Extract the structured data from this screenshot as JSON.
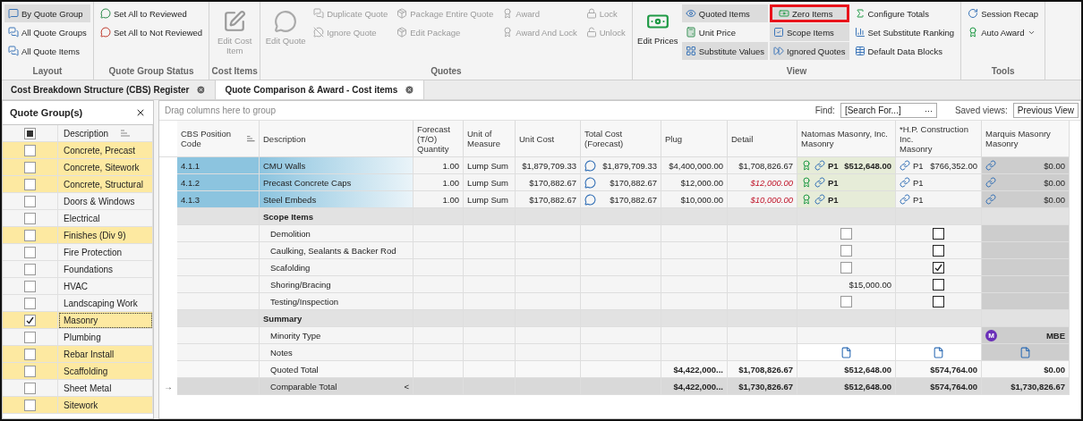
{
  "ribbon": {
    "groups": [
      {
        "label": "Layout",
        "columns": [
          [
            {
              "label": "By Quote Group",
              "kind": "small",
              "selected": true,
              "disabled": false,
              "outlined": false
            },
            {
              "label": "All Quote Groups",
              "kind": "small",
              "selected": false,
              "disabled": false,
              "outlined": false
            },
            {
              "label": "All Quote Items",
              "kind": "small",
              "selected": false,
              "disabled": false,
              "outlined": false
            }
          ]
        ]
      },
      {
        "label": "Quote Group Status",
        "columns": [
          [
            {
              "label": "Set All to Reviewed",
              "kind": "small",
              "selected": false,
              "disabled": false,
              "outlined": false
            },
            {
              "label": "Set All to Not Reviewed",
              "kind": "small",
              "selected": false,
              "disabled": false,
              "outlined": false
            }
          ]
        ]
      },
      {
        "label": "Cost Items",
        "columns": [
          [
            {
              "label": "Edit Cost Item",
              "kind": "large",
              "selected": false,
              "disabled": true,
              "outlined": false
            }
          ]
        ]
      },
      {
        "label": "Quotes",
        "columns": [
          [
            {
              "label": "Edit Quote",
              "kind": "large",
              "selected": false,
              "disabled": true,
              "outlined": false
            }
          ],
          [
            {
              "label": "Duplicate Quote",
              "kind": "small",
              "selected": false,
              "disabled": true,
              "outlined": false
            },
            {
              "label": "Ignore Quote",
              "kind": "small",
              "selected": false,
              "disabled": true,
              "outlined": false
            }
          ],
          [
            {
              "label": "Package Entire Quote",
              "kind": "small",
              "selected": false,
              "disabled": true,
              "outlined": false
            },
            {
              "label": "Edit Package",
              "kind": "small",
              "selected": false,
              "disabled": true,
              "outlined": false
            }
          ],
          [
            {
              "label": "Award",
              "kind": "small",
              "selected": false,
              "disabled": true,
              "outlined": false
            },
            {
              "label": "Award And Lock",
              "kind": "small",
              "selected": false,
              "disabled": true,
              "outlined": false
            }
          ],
          [
            {
              "label": "Lock",
              "kind": "small",
              "selected": false,
              "disabled": true,
              "outlined": false
            },
            {
              "label": "Unlock",
              "kind": "small",
              "selected": false,
              "disabled": true,
              "outlined": false
            }
          ]
        ]
      },
      {
        "label": "View",
        "columns": [
          [
            {
              "label": "Edit Prices",
              "kind": "large",
              "selected": false,
              "disabled": false,
              "outlined": false
            }
          ],
          [
            {
              "label": "Quoted Items",
              "kind": "small",
              "selected": true,
              "disabled": false,
              "outlined": false
            },
            {
              "label": "Unit Price",
              "kind": "small",
              "selected": false,
              "disabled": false,
              "outlined": false
            },
            {
              "label": "Substitute Values",
              "kind": "small",
              "selected": true,
              "disabled": false,
              "outlined": false
            }
          ],
          [
            {
              "label": "Zero Items",
              "kind": "small",
              "selected": true,
              "disabled": false,
              "outlined": true
            },
            {
              "label": "Scope Items",
              "kind": "small",
              "selected": true,
              "disabled": false,
              "outlined": false
            },
            {
              "label": "Ignored Quotes",
              "kind": "small",
              "selected": true,
              "disabled": false,
              "outlined": false
            }
          ],
          [
            {
              "label": "Configure Totals",
              "kind": "small",
              "selected": false,
              "disabled": false,
              "outlined": false
            },
            {
              "label": "Set Substitute Ranking",
              "kind": "small",
              "selected": false,
              "disabled": false,
              "outlined": false
            },
            {
              "label": "Default Data Blocks",
              "kind": "small",
              "selected": false,
              "disabled": false,
              "outlined": false
            }
          ]
        ]
      },
      {
        "label": "Tools",
        "columns": [
          [
            {
              "label": "Session Recap",
              "kind": "small",
              "selected": false,
              "disabled": false,
              "outlined": false,
              "dropdown": false
            },
            {
              "label": "Auto Award",
              "kind": "small",
              "selected": false,
              "disabled": false,
              "outlined": false,
              "dropdown": true
            }
          ]
        ]
      }
    ]
  },
  "tabs": [
    {
      "label": "Cost Breakdown Structure (CBS) Register",
      "selected": false
    },
    {
      "label": "Quote Comparison & Award - Cost items",
      "selected": true
    }
  ],
  "quote_groups": {
    "title": "Quote Group(s)",
    "header": {
      "label": "Description",
      "indeterminate": true
    },
    "rows": [
      {
        "label": "Concrete, Precast",
        "checked": false,
        "highlighted": true,
        "selected": false
      },
      {
        "label": "Concrete, Sitework",
        "checked": false,
        "highlighted": true,
        "selected": false
      },
      {
        "label": "Concrete, Structural",
        "checked": false,
        "highlighted": true,
        "selected": false
      },
      {
        "label": "Doors & Windows",
        "checked": false,
        "highlighted": false,
        "selected": false
      },
      {
        "label": "Electrical",
        "checked": false,
        "highlighted": false,
        "selected": false
      },
      {
        "label": "Finishes (Div 9)",
        "checked": false,
        "highlighted": true,
        "selected": false
      },
      {
        "label": "Fire Protection",
        "checked": false,
        "highlighted": false,
        "selected": false
      },
      {
        "label": "Foundations",
        "checked": false,
        "highlighted": false,
        "selected": false
      },
      {
        "label": "HVAC",
        "checked": false,
        "highlighted": false,
        "selected": false
      },
      {
        "label": "Landscaping Work",
        "checked": false,
        "highlighted": false,
        "selected": false
      },
      {
        "label": "Masonry",
        "checked": true,
        "highlighted": true,
        "selected": true
      },
      {
        "label": "Plumbing",
        "checked": false,
        "highlighted": false,
        "selected": false
      },
      {
        "label": "Rebar Install",
        "checked": false,
        "highlighted": true,
        "selected": false
      },
      {
        "label": "Scaffolding",
        "checked": false,
        "highlighted": true,
        "selected": false
      },
      {
        "label": "Sheet Metal",
        "checked": false,
        "highlighted": false,
        "selected": false
      },
      {
        "label": "Sitework",
        "checked": false,
        "highlighted": true,
        "selected": false
      }
    ]
  },
  "grid": {
    "group_hint": "Drag columns here to group",
    "find": {
      "label": "Find:",
      "placeholder": "[Search For...]",
      "button": "···"
    },
    "saved_views": {
      "label": "Saved views:",
      "value": "Previous View"
    },
    "columns": [
      {
        "label": "CBS Position Code",
        "sorted": true
      },
      {
        "label": "Description",
        "sorted": false
      },
      {
        "label": "Forecast (T/O) Quantity",
        "sorted": false
      },
      {
        "label": "Unit of Measure",
        "sorted": false
      },
      {
        "label": "Unit Cost",
        "sorted": false
      },
      {
        "label": "Total Cost (Forecast)",
        "sorted": false
      },
      {
        "label": "Plug",
        "sorted": false
      },
      {
        "label": "Detail",
        "sorted": false
      }
    ],
    "vendors": [
      {
        "name": "Natomas Masonry, Inc.",
        "trade": "Masonry",
        "excluded": false
      },
      {
        "name": "*H.P. Construction Inc.",
        "trade": "Masonry",
        "excluded": false
      },
      {
        "name": "Marquis Masonry",
        "trade": "Masonry",
        "excluded": true
      }
    ],
    "rows": [
      {
        "kind": "item",
        "code": "4.1.1",
        "description": "CMU Walls",
        "quantity": "1.00",
        "unit": "Lump Sum",
        "unit_cost": "$1,879,709.33",
        "total": "$1,879,709.33",
        "commented": true,
        "plug": "$4,400,000.00",
        "detail": "$1,708,826.67",
        "detail_overridden": false,
        "quotes": [
          {
            "awarded": true,
            "linked": true,
            "priority": "P1",
            "amount": "$512,648.00"
          },
          {
            "awarded": false,
            "linked": true,
            "priority": "P1",
            "amount": "$766,352.00"
          },
          {
            "awarded": false,
            "linked": true,
            "amount": "$0.00"
          }
        ]
      },
      {
        "kind": "item",
        "code": "4.1.2",
        "description": "Precast Concrete Caps",
        "quantity": "1.00",
        "unit": "Lump Sum",
        "unit_cost": "$170,882.67",
        "total": "$170,882.67",
        "commented": true,
        "plug": "$12,000.00",
        "detail": "$12,000.00",
        "detail_overridden": true,
        "quotes": [
          {
            "awarded": true,
            "linked": true,
            "priority": "P1"
          },
          {
            "awarded": false,
            "linked": true,
            "priority": "P1"
          },
          {
            "awarded": false,
            "linked": true,
            "amount": "$0.00"
          }
        ]
      },
      {
        "kind": "item",
        "code": "4.1.3",
        "description": "Steel Embeds",
        "quantity": "1.00",
        "unit": "Lump Sum",
        "unit_cost": "$170,882.67",
        "total": "$170,882.67",
        "commented": true,
        "plug": "$10,000.00",
        "detail": "$10,000.00",
        "detail_overridden": true,
        "quotes": [
          {
            "awarded": true,
            "linked": true,
            "priority": "P1"
          },
          {
            "awarded": false,
            "linked": true,
            "priority": "P1"
          },
          {
            "awarded": false,
            "linked": true,
            "amount": "$0.00"
          }
        ]
      },
      {
        "kind": "section",
        "label": "Scope Items"
      },
      {
        "kind": "detail",
        "label": "Demolition",
        "quotes": [
          {
            "kind": "check",
            "checked": false
          },
          {
            "kind": "check",
            "checked": false
          }
        ]
      },
      {
        "kind": "detail",
        "label": "Caulking, Sealants & Backer Rod",
        "quotes": [
          {
            "kind": "check",
            "checked": false
          },
          {
            "kind": "check",
            "checked": false
          }
        ]
      },
      {
        "kind": "detail",
        "label": "Scafolding",
        "quotes": [
          {
            "kind": "check",
            "checked": false
          },
          {
            "kind": "check",
            "checked": true
          }
        ]
      },
      {
        "kind": "detail",
        "label": "Shoring/Bracing",
        "quotes": [
          {
            "kind": "value",
            "text": "$15,000.00"
          },
          {
            "kind": "check",
            "checked": false
          }
        ]
      },
      {
        "kind": "detail",
        "label": "Testing/Inspection",
        "quotes": [
          {
            "kind": "check",
            "checked": false
          },
          {
            "kind": "check",
            "checked": false
          }
        ]
      },
      {
        "kind": "section",
        "label": "Summary"
      },
      {
        "kind": "detail",
        "label": "Minority Type",
        "quotes": [
          {
            "kind": "blank"
          },
          {
            "kind": "blank"
          },
          {
            "kind": "badge",
            "badge": "M",
            "text": "MBE",
            "color": "#6a2fb8"
          }
        ]
      },
      {
        "kind": "detail",
        "label": "Notes",
        "quotes": [
          {
            "kind": "note"
          },
          {
            "kind": "note"
          },
          {
            "kind": "note"
          }
        ]
      },
      {
        "kind": "total",
        "label": "Quoted Total",
        "current": false,
        "plug": "$4,422,000...",
        "detail": "$1,708,826.67",
        "quotes": [
          "$512,648.00",
          "$574,764.00",
          "$0.00"
        ]
      },
      {
        "kind": "total",
        "label": "Comparable Total",
        "current": true,
        "indicator": "→",
        "marker": "<",
        "plug": "$4,422,000...",
        "detail": "$1,730,826.67",
        "quotes": [
          "$512,648.00",
          "$574,764.00",
          "$1,730,826.67"
        ]
      }
    ]
  }
}
